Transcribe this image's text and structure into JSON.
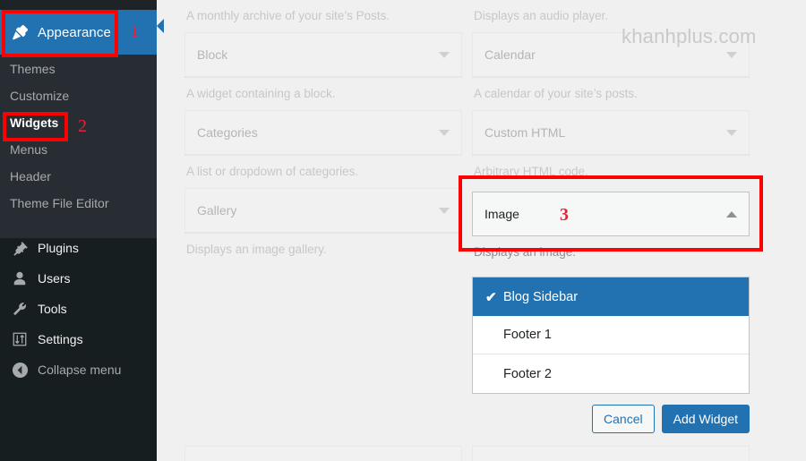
{
  "colors": {
    "wp_blue": "#2271b1",
    "annotation_red": "#ff0000",
    "annotation_number_red": "#e8203a",
    "sidebar_dark": "#171e20",
    "sidebar_submenu_bg": "#282d33",
    "content_bg": "#f0f0f1"
  },
  "sidebar": {
    "appearance": {
      "label": "Appearance",
      "icon": "appearance-brush-icon",
      "annotation_number": "1"
    },
    "submenu": [
      {
        "label": "Themes",
        "current": false
      },
      {
        "label": "Customize",
        "current": false
      },
      {
        "label": "Widgets",
        "current": true
      },
      {
        "label": "Menus",
        "current": false
      },
      {
        "label": "Header",
        "current": false
      },
      {
        "label": "Theme File Editor",
        "current": false
      }
    ],
    "widgets_annotation_number": "2",
    "items": [
      {
        "label": "Plugins",
        "icon": "plugin-icon"
      },
      {
        "label": "Users",
        "icon": "user-icon"
      },
      {
        "label": "Tools",
        "icon": "wrench-icon"
      },
      {
        "label": "Settings",
        "icon": "sliders-icon"
      },
      {
        "label": "Collapse menu",
        "icon": "collapse-arrow-icon"
      }
    ]
  },
  "watermark": "khanhplus.com",
  "main": {
    "left_column": [
      {
        "desc_above": "A monthly archive of your site’s Posts.",
        "title": "Block",
        "desc": "A widget containing a block."
      },
      {
        "title": "Categories",
        "desc": "A list or dropdown of categories."
      },
      {
        "title": "Gallery",
        "desc": "Displays an image gallery."
      }
    ],
    "right_column": [
      {
        "desc_above": "Displays an audio player.",
        "title": "Calendar",
        "desc": "A calendar of your site’s posts."
      },
      {
        "title": "Custom HTML",
        "desc": "Arbitrary HTML code."
      }
    ],
    "image_widget": {
      "title": "Image",
      "desc": "Displays an image.",
      "annotation_number": "3",
      "caret": "caret-up-icon"
    },
    "sidebar_chooser": {
      "options": [
        {
          "label": "Blog Sidebar",
          "selected": true,
          "check": "✔"
        },
        {
          "label": "Footer 1",
          "selected": false
        },
        {
          "label": "Footer 2",
          "selected": false
        }
      ],
      "cancel_label": "Cancel",
      "add_label": "Add Widget"
    }
  }
}
